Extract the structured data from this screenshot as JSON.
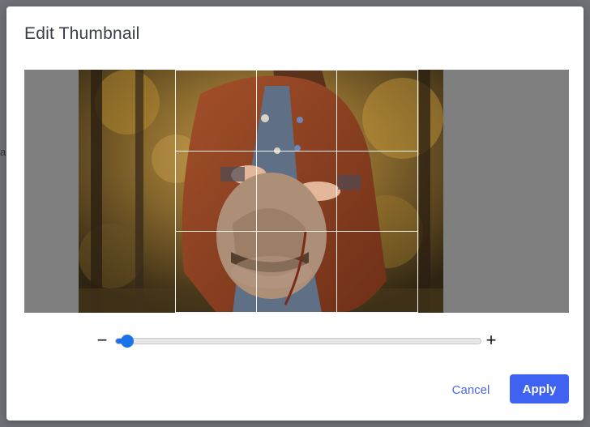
{
  "dialog": {
    "title": "Edit Thumbnail"
  },
  "background": {
    "fragment_text": "a"
  },
  "editor": {
    "image_description_icon": "photo-image",
    "zoom": {
      "minus_icon": "−",
      "plus_icon": "+",
      "level": 0.03
    }
  },
  "actions": {
    "cancel_label": "Cancel",
    "apply_label": "Apply"
  },
  "colors": {
    "accent": "#3f62f2",
    "link": "#4a68e6",
    "slider_thumb": "#1a73e8",
    "crop_background": "#7f7f7f"
  }
}
